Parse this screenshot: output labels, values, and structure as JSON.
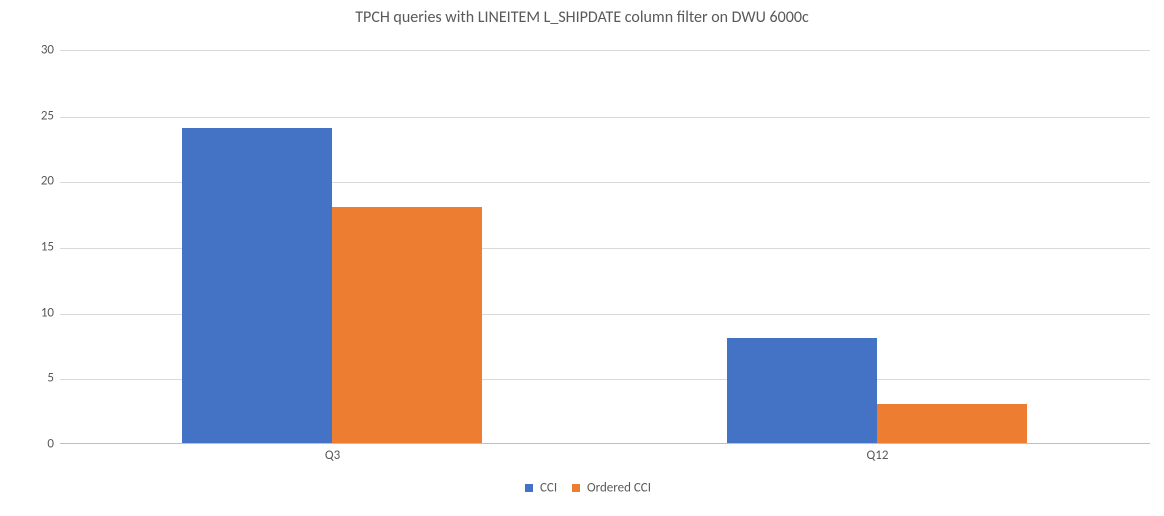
{
  "chart_data": {
    "type": "bar",
    "title": "TPCH queries with LINEITEM L_SHIPDATE column filter on DWU 6000c",
    "categories": [
      "Q3",
      "Q12"
    ],
    "series": [
      {
        "name": "CCI",
        "values": [
          24,
          8
        ],
        "color": "#4472c4"
      },
      {
        "name": "Ordered CCI",
        "values": [
          18,
          3
        ],
        "color": "#ed7d31"
      }
    ],
    "ylim": [
      0,
      30
    ],
    "y_ticks": [
      0,
      5,
      10,
      15,
      20,
      25,
      30
    ],
    "xlabel": "",
    "ylabel": ""
  }
}
